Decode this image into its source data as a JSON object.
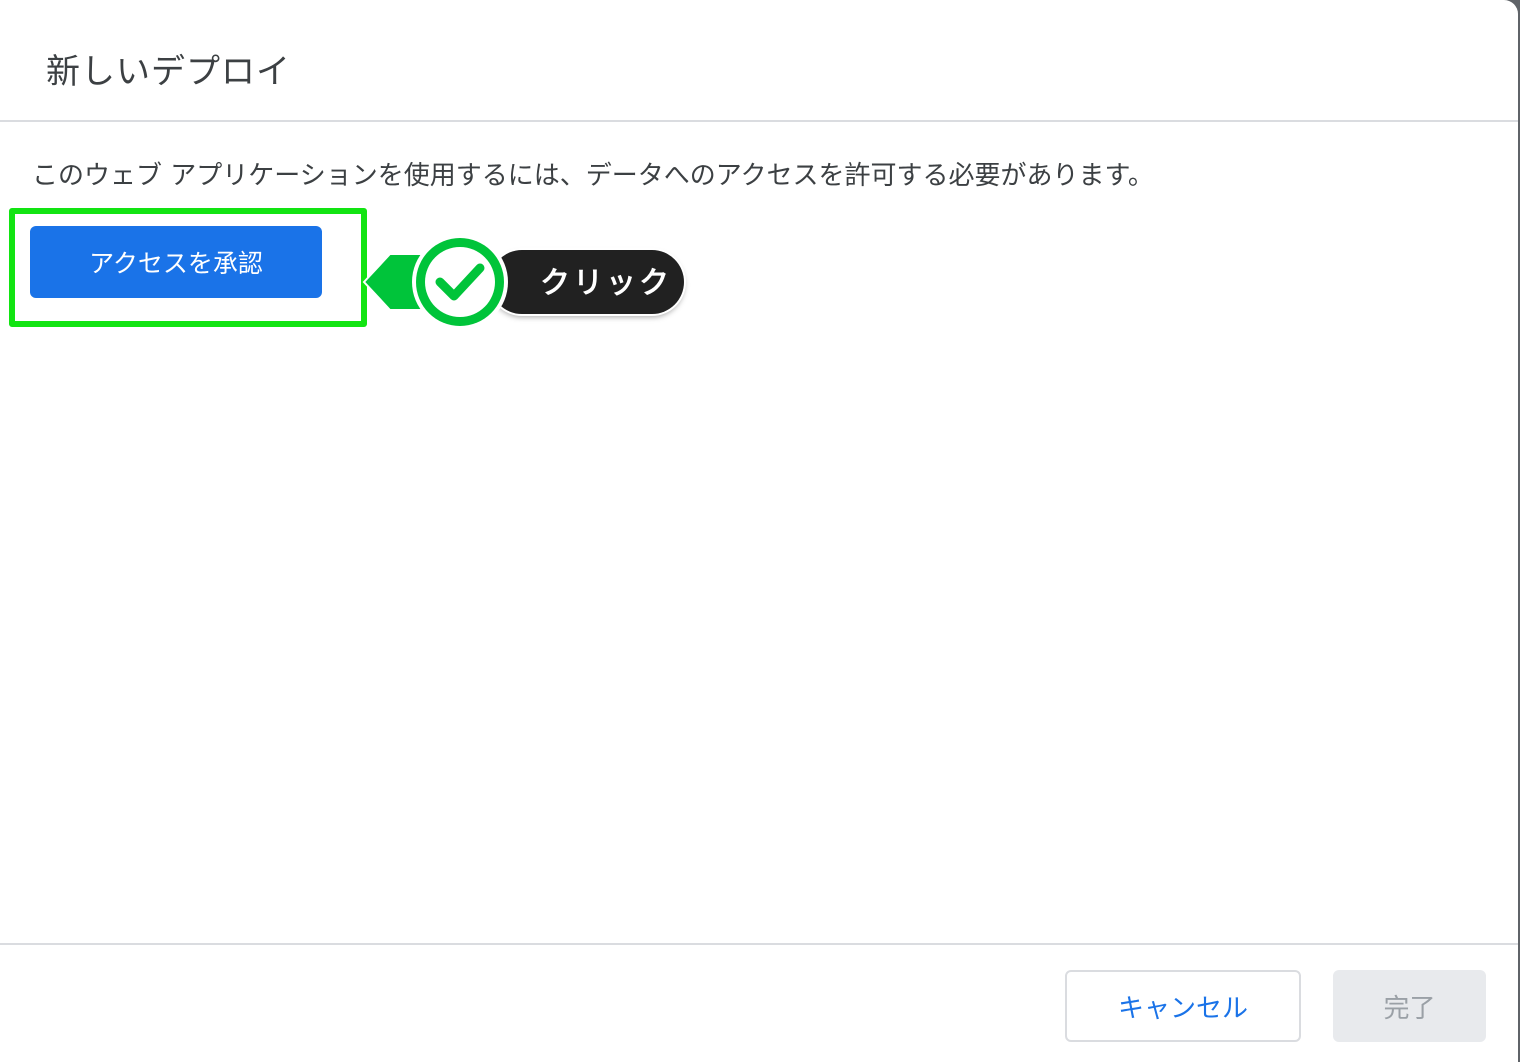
{
  "dialog": {
    "title": "新しいデプロイ",
    "message": "このウェブ アプリケーションを使用するには、データへのアクセスを許可する必要があります。",
    "authorize_label": "アクセスを承認",
    "cancel_label": "キャンセル",
    "done_label": "完了"
  },
  "annotation": {
    "label": "クリック",
    "icon": "check-icon",
    "highlight_color": "#12e412",
    "badge_color": "#00c43a"
  },
  "colors": {
    "primary": "#1a73e8",
    "disabled_bg": "#e8eaed",
    "disabled_text": "#9aa0a6"
  }
}
